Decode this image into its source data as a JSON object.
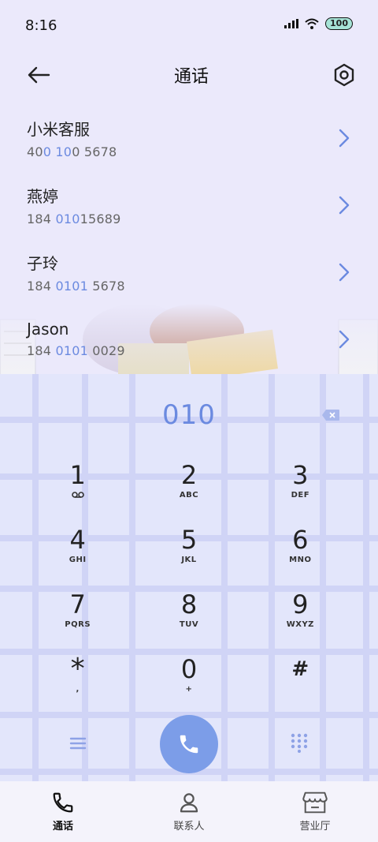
{
  "status_bar": {
    "time": "8:16",
    "battery": "100"
  },
  "header": {
    "title": "通话",
    "back_icon": "arrow-left-icon",
    "settings_icon": "hexagon-settings-icon"
  },
  "contacts": [
    {
      "name": "小米客服",
      "number_parts": [
        "40",
        "0 10",
        "0 5678"
      ]
    },
    {
      "name": "燕婷",
      "number_parts": [
        "184 ",
        "010",
        "15689"
      ]
    },
    {
      "name": "子玲",
      "number_parts": [
        "184 ",
        "0101",
        " 5678"
      ]
    },
    {
      "name": "Jason",
      "number_parts": [
        "184 ",
        "0101",
        " 0029"
      ]
    }
  ],
  "dialpad": {
    "input_value": "010",
    "keys": [
      {
        "digit": "1",
        "letters": ""
      },
      {
        "digit": "2",
        "letters": "ABC"
      },
      {
        "digit": "3",
        "letters": "DEF"
      },
      {
        "digit": "4",
        "letters": "GHI"
      },
      {
        "digit": "5",
        "letters": "JKL"
      },
      {
        "digit": "6",
        "letters": "MNO"
      },
      {
        "digit": "7",
        "letters": "PQRS"
      },
      {
        "digit": "8",
        "letters": "TUV"
      },
      {
        "digit": "9",
        "letters": "WXYZ"
      },
      {
        "digit": "*",
        "letters": ","
      },
      {
        "digit": "0",
        "letters": "+"
      },
      {
        "digit": "#",
        "letters": ""
      }
    ]
  },
  "tabbar": {
    "tabs": [
      {
        "label": "通话",
        "icon": "phone-icon",
        "active": true
      },
      {
        "label": "联系人",
        "icon": "person-icon",
        "active": false
      },
      {
        "label": "营业厅",
        "icon": "store-icon",
        "active": false
      }
    ]
  },
  "colors": {
    "accent": "#6b8ae0",
    "call_button": "#7c9de8",
    "background": "#ebe9fb"
  }
}
